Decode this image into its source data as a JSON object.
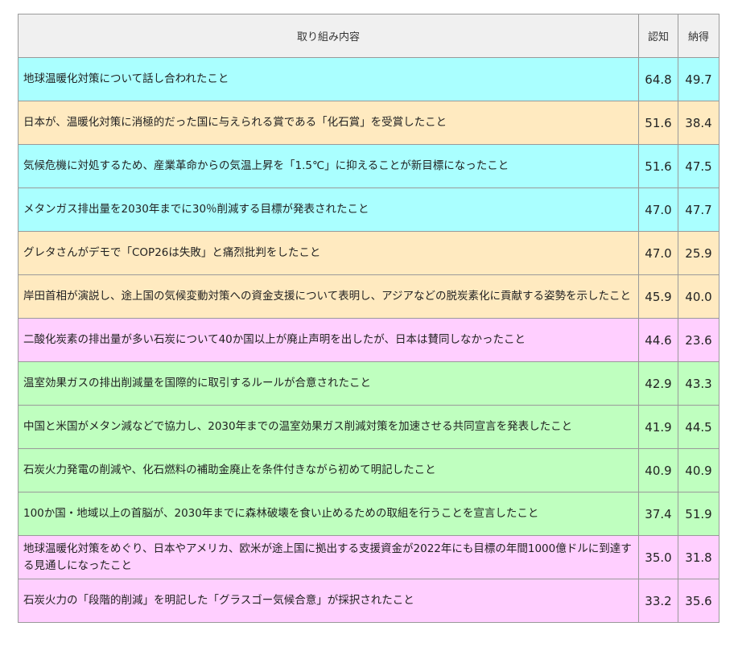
{
  "colors": {
    "blue": "#aaffff",
    "orange": "#ffeac0",
    "pink": "#ffcfff",
    "green": "#bfffbf",
    "header": "#f0f0f0"
  },
  "table": {
    "headers": [
      "取り組み内容",
      "認知",
      "納得"
    ],
    "rows": [
      {
        "item": "地球温暖化対策について話し合われたこと",
        "recognition": "64.8",
        "agreement": "49.7",
        "color": "blue"
      },
      {
        "item": "日本が、温暖化対策に消極的だった国に与えられる賞である「化石賞」を受賞したこと",
        "recognition": "51.6",
        "agreement": "38.4",
        "color": "orange"
      },
      {
        "item": "気候危機に対処するため、産業革命からの気温上昇を「1.5℃」に抑えることが新目標になったこと",
        "recognition": "51.6",
        "agreement": "47.5",
        "color": "blue"
      },
      {
        "item": "メタンガス排出量を2030年までに30％削減する目標が発表されたこと",
        "recognition": "47.0",
        "agreement": "47.7",
        "color": "blue"
      },
      {
        "item": "グレタさんがデモで「COP26は失敗」と痛烈批判をしたこと",
        "recognition": "47.0",
        "agreement": "25.9",
        "color": "orange"
      },
      {
        "item": "岸田首相が演説し、途上国の気候変動対策への資金支援について表明し、アジアなどの脱炭素化に貢献する姿勢を示したこと",
        "recognition": "45.9",
        "agreement": "40.0",
        "color": "orange"
      },
      {
        "item": "二酸化炭素の排出量が多い石炭について40か国以上が廃止声明を出したが、日本は賛同しなかったこと",
        "recognition": "44.6",
        "agreement": "23.6",
        "color": "pink"
      },
      {
        "item": "温室効果ガスの排出削減量を国際的に取引するルールが合意されたこと",
        "recognition": "42.9",
        "agreement": "43.3",
        "color": "green"
      },
      {
        "item": "中国と米国がメタン減などで協力し、2030年までの温室効果ガス削減対策を加速させる共同宣言を発表したこと",
        "recognition": "41.9",
        "agreement": "44.5",
        "color": "green"
      },
      {
        "item": "石炭火力発電の削減や、化石燃料の補助金廃止を条件付きながら初めて明記したこと",
        "recognition": "40.9",
        "agreement": "40.9",
        "color": "green"
      },
      {
        "item": "100か国・地域以上の首脳が、2030年までに森林破壊を食い止めるための取組を行うことを宣言したこと",
        "recognition": "37.4",
        "agreement": "51.9",
        "color": "green"
      },
      {
        "item": "地球温暖化対策をめぐり、日本やアメリカ、欧米が途上国に拠出する支援資金が2022年にも目標の年間1000億ドルに到達する見通しになったこと",
        "recognition": "35.0",
        "agreement": "31.8",
        "color": "pink"
      },
      {
        "item": "石炭火力の「段階的削減」を明記した「グラスゴー気候合意」が採択されたこと",
        "recognition": "33.2",
        "agreement": "35.6",
        "color": "pink"
      }
    ]
  }
}
